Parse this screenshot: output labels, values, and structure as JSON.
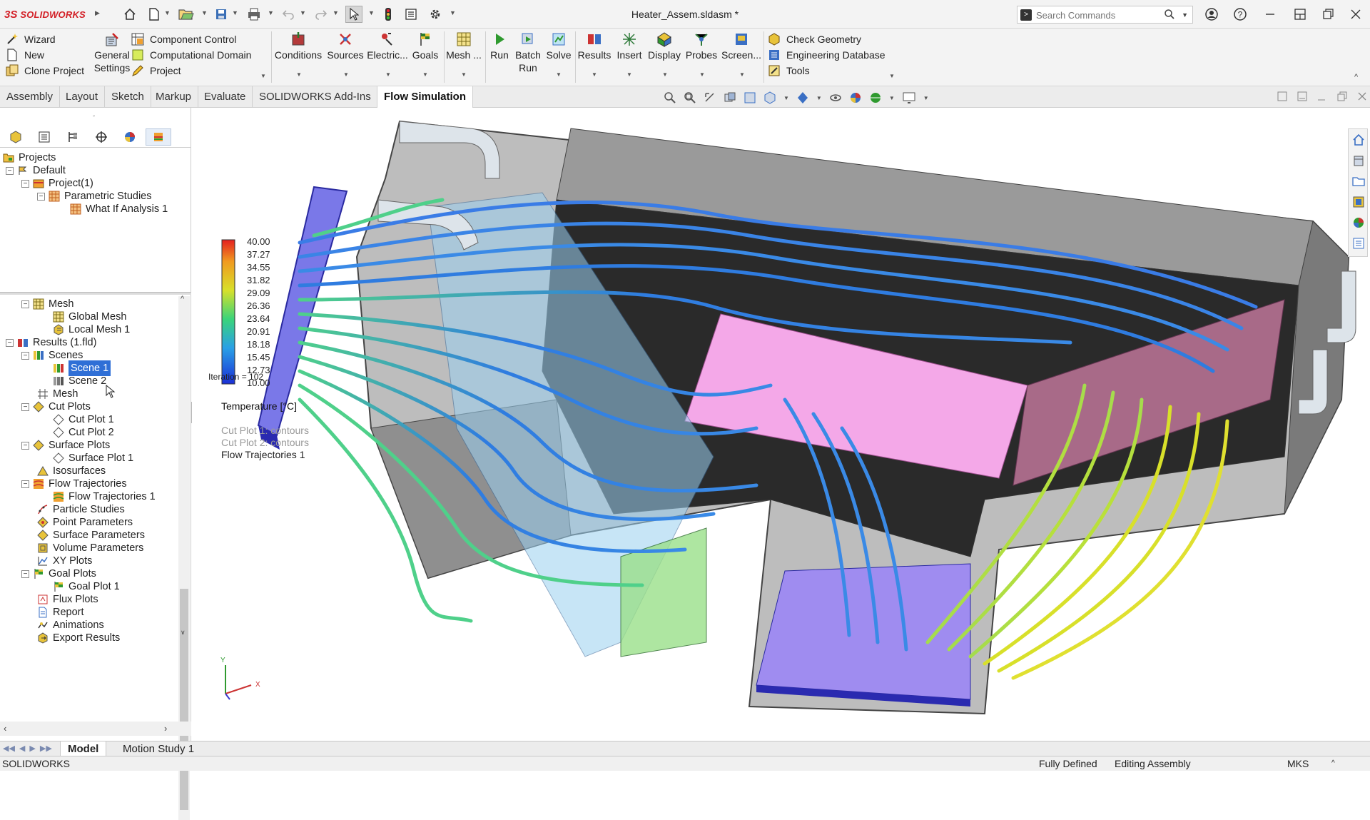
{
  "app": {
    "name": "SOLIDWORKS",
    "logo_mark": "3S",
    "document_title": "Heater_Assem.sldasm *"
  },
  "search": {
    "placeholder": "Search Commands"
  },
  "ribbon": {
    "left_col": [
      "Wizard",
      "New",
      "Clone Project"
    ],
    "general_settings": [
      "General",
      "Settings"
    ],
    "mid_col": [
      "Component Control",
      "Computational Domain",
      "Project"
    ],
    "big_buttons": [
      "Conditions",
      "Sources",
      "Electric...",
      "Goals",
      "Mesh ...",
      "Run",
      "Batch",
      "Run",
      "Solve",
      "Results",
      "Insert",
      "Display",
      "Probes",
      "Screen..."
    ],
    "right_col": [
      "Check Geometry",
      "Engineering Database",
      "Tools"
    ]
  },
  "tabs": [
    "Assembly",
    "Layout",
    "Sketch",
    "Markup",
    "Evaluate",
    "SOLIDWORKS Add-Ins",
    "Flow Simulation"
  ],
  "tree_top": [
    "Projects",
    "Default",
    "Project(1)",
    "Parametric Studies",
    "What If Analysis 1"
  ],
  "tree_bottom": [
    "Mesh",
    "Global Mesh",
    "Local Mesh 1",
    "Results (1.fld)",
    "Scenes",
    "Scene 1",
    "Scene 2",
    "Mesh",
    "Cut Plots",
    "Cut Plot 1",
    "Cut Plot 2",
    "Surface Plots",
    "Surface Plot 1",
    "Isosurfaces",
    "Flow Trajectories",
    "Flow Trajectories 1",
    "Particle Studies",
    "Point Parameters",
    "Surface Parameters",
    "Volume Parameters",
    "XY Plots",
    "Goal Plots",
    "Goal Plot 1",
    "Flux Plots",
    "Report",
    "Animations",
    "Export Results"
  ],
  "legend": {
    "ticks": [
      "40.00",
      "37.27",
      "34.55",
      "31.82",
      "29.09",
      "26.36",
      "23.64",
      "20.91",
      "18.18",
      "15.45",
      "12.73",
      "10.00"
    ],
    "title": "Temperature [°C]",
    "iteration": "Iteration = 102",
    "info": [
      "Cut Plot 1: contours",
      "Cut Plot 2: contours",
      "Flow Trajectories 1"
    ]
  },
  "triad": {
    "y": "Y",
    "x": "X"
  },
  "bottom_tabs": [
    "Model",
    "Motion Study 1"
  ],
  "status": {
    "app": "SOLIDWORKS",
    "fully_defined": "Fully Defined",
    "editing": "Editing Assembly",
    "units": "MKS"
  }
}
